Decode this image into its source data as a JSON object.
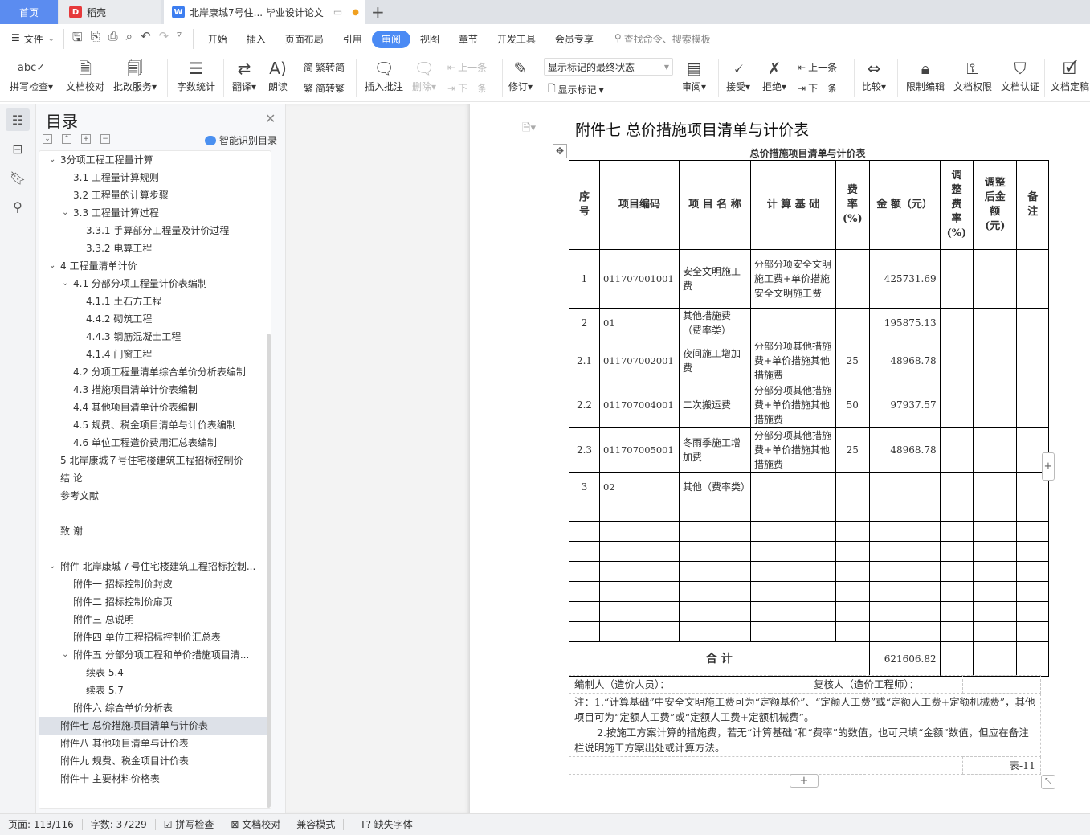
{
  "tabs": {
    "home": "首页",
    "daoke": "稻壳",
    "doc": "北岸康城7号住... 毕业设计论文"
  },
  "menu": {
    "file": "文件",
    "items": [
      "开始",
      "插入",
      "页面布局",
      "引用",
      "审阅",
      "视图",
      "章节",
      "开发工具",
      "会员专享"
    ],
    "active": "审阅",
    "search": "查找命令、搜索模板"
  },
  "toolbar": {
    "spell": "拼写检查",
    "proof": "文档校对",
    "correct": "批改服务",
    "wordcount": "字数统计",
    "translate": "翻译",
    "read": "朗读",
    "t2s": "繁转简",
    "s2t": "简转繁",
    "insert_comment": "插入批注",
    "delete": "删除",
    "prev_comment": "上一条",
    "next_comment": "下一条",
    "revise": "修订",
    "markup_select": "显示标记的最终状态",
    "show_markup": "显示标记",
    "review": "审阅",
    "accept": "接受",
    "reject": "拒绝",
    "prev": "上一条",
    "next": "下一条",
    "compare": "比较",
    "restrict": "限制编辑",
    "permission": "文档权限",
    "certify": "文档认证",
    "finalize": "文档定稿"
  },
  "toc": {
    "title": "目录",
    "smart": "智能识别目录",
    "items": [
      {
        "t": "3分项工程工程量计算",
        "l": 1,
        "exp": true
      },
      {
        "t": "3.1  工程量计算规则",
        "l": 2
      },
      {
        "t": "3.2  工程量的计算步骤",
        "l": 2
      },
      {
        "t": "3.3  工程量计算过程",
        "l": 2,
        "exp": true
      },
      {
        "t": "3.3.1  手算部分工程量及计价过程",
        "l": 3
      },
      {
        "t": "3.3.2  电算工程",
        "l": 3
      },
      {
        "t": "4  工程量清单计价",
        "l": 1,
        "exp": true
      },
      {
        "t": "4.1  分部分项工程量计价表编制",
        "l": 2,
        "exp": true
      },
      {
        "t": "4.1.1  土石方工程",
        "l": 3
      },
      {
        "t": "4.4.2  砌筑工程",
        "l": 3
      },
      {
        "t": "4.4.3  钢筋混凝土工程",
        "l": 3
      },
      {
        "t": "4.1.4  门窗工程",
        "l": 3
      },
      {
        "t": "4.2  分项工程量清单综合单价分析表编制",
        "l": 2
      },
      {
        "t": "4.3  措施项目清单计价表编制",
        "l": 2
      },
      {
        "t": "4.4  其他项目清单计价表编制",
        "l": 2
      },
      {
        "t": "4.5  规费、税金项目清单与计价表编制",
        "l": 2
      },
      {
        "t": "4.6  单位工程造价费用汇总表编制",
        "l": 2
      },
      {
        "t": "5  北岸康城７号住宅楼建筑工程招标控制价",
        "l": 1
      },
      {
        "t": "结  论",
        "l": 1
      },
      {
        "t": "参考文献",
        "l": 1
      },
      {
        "t": "致  谢",
        "l": 1,
        "gap": true
      },
      {
        "t": "附件  北岸康城７号住宅楼建筑工程招标控制...",
        "l": 1,
        "exp": true,
        "gap": true
      },
      {
        "t": "附件一  招标控制价封皮",
        "l": 2
      },
      {
        "t": "附件二  招标控制价扉页",
        "l": 2
      },
      {
        "t": "附件三  总说明",
        "l": 2
      },
      {
        "t": "附件四  单位工程招标控制价汇总表",
        "l": 2
      },
      {
        "t": "附件五  分部分项工程和单价措施项目清...",
        "l": 2,
        "exp": true
      },
      {
        "t": "续表  5.4",
        "l": 3
      },
      {
        "t": "续表  5.7",
        "l": 3
      },
      {
        "t": "附件六  综合单价分析表",
        "l": 2
      },
      {
        "t": "附件七  总价措施项目清单与计价表",
        "l": 1,
        "sel": true
      },
      {
        "t": "附件八  其他项目清单与计价表",
        "l": 1
      },
      {
        "t": "附件九  规费、税金项目计价表",
        "l": 1
      },
      {
        "t": "附件十  主要材料价格表",
        "l": 1
      }
    ]
  },
  "doc": {
    "title": "附件七  总价措施项目清单与计价表",
    "table_title": "总价措施项目清单与计价表",
    "headers": [
      "序号",
      "项目编码",
      "项 目 名 称",
      "计 算 基 础",
      "费率(%)",
      "金 额（元）",
      "调整费率(%)",
      "调整后金额(元)",
      "备注"
    ],
    "rows": [
      [
        "1",
        "011707001001",
        "安全文明施工费",
        "分部分项安全文明施工费+单价措施安全文明施工费",
        "",
        "425731.69",
        "",
        "",
        ""
      ],
      [
        "2",
        "01",
        "其他措施费（费率类）",
        "",
        "",
        "195875.13",
        "",
        "",
        ""
      ],
      [
        "2.1",
        "011707002001",
        "夜间施工增加费",
        "分部分项其他措施费+单价措施其他措施费",
        "25",
        "48968.78",
        "",
        "",
        ""
      ],
      [
        "2.2",
        "011707004001",
        "二次搬运费",
        "分部分项其他措施费+单价措施其他措施费",
        "50",
        "97937.57",
        "",
        "",
        ""
      ],
      [
        "2.3",
        "011707005001",
        "冬雨季施工增加费",
        "分部分项其他措施费+单价措施其他措施费",
        "25",
        "48968.78",
        "",
        "",
        ""
      ],
      [
        "3",
        "02",
        "其他（费率类）",
        "",
        "",
        "",
        "",
        "",
        ""
      ]
    ],
    "empty_rows": 7,
    "total_label": "合  计",
    "total": "621606.82",
    "preparer": "编制人（造价人员）：",
    "reviewer": "复核人（造价工程师）：",
    "note1": "注：1.“计算基础”中安全文明施工费可为“定额基价”、“定额人工费”或“定额人工费+定额机械费”，其他项目可为“定额人工费”或“定额人工费+定额机械费”。",
    "note2": "2.按施工方案计算的措施费，若无“计算基础”和“费率”的数值，也可只填“金额”数值，但应在备注栏说明施工方案出处或计算方法。",
    "table_no": "表-11"
  },
  "status": {
    "page": "页面: 113/116",
    "words": "字数: 37229",
    "spell": "拼写检查",
    "proof": "文档校对",
    "compat": "兼容模式",
    "missing_font": "缺失字体"
  }
}
